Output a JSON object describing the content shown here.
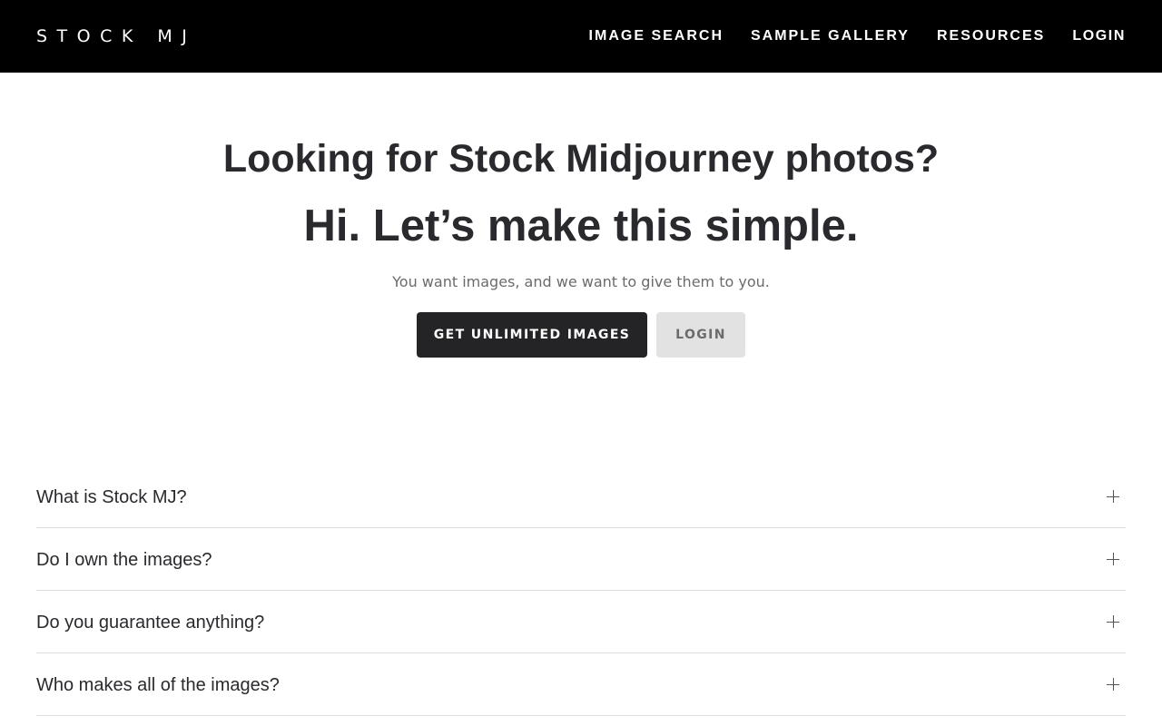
{
  "header": {
    "logo": "STOCK MJ",
    "nav": [
      {
        "label": "IMAGE SEARCH"
      },
      {
        "label": "SAMPLE GALLERY"
      },
      {
        "label": "RESOURCES"
      },
      {
        "label": "LOGIN"
      }
    ],
    "background_color": "#000000"
  },
  "hero": {
    "title": "Looking for Stock Midjourney photos?",
    "subtitle": "Hi. Let’s make this simple.",
    "text": "You want images, and we want to give them to you.",
    "primary_button": "GET UNLIMITED IMAGES",
    "secondary_button": "LOGIN",
    "primary_button_color": "#242426",
    "secondary_button_color": "#e2e2e2"
  },
  "faq": {
    "items": [
      {
        "question": "What is Stock MJ?",
        "icon": "plus-icon"
      },
      {
        "question": "Do I own the images?",
        "icon": "plus-icon"
      },
      {
        "question": "Do you guarantee anything?",
        "icon": "plus-icon"
      },
      {
        "question": "Who makes all of the images?",
        "icon": "plus-icon"
      }
    ]
  }
}
